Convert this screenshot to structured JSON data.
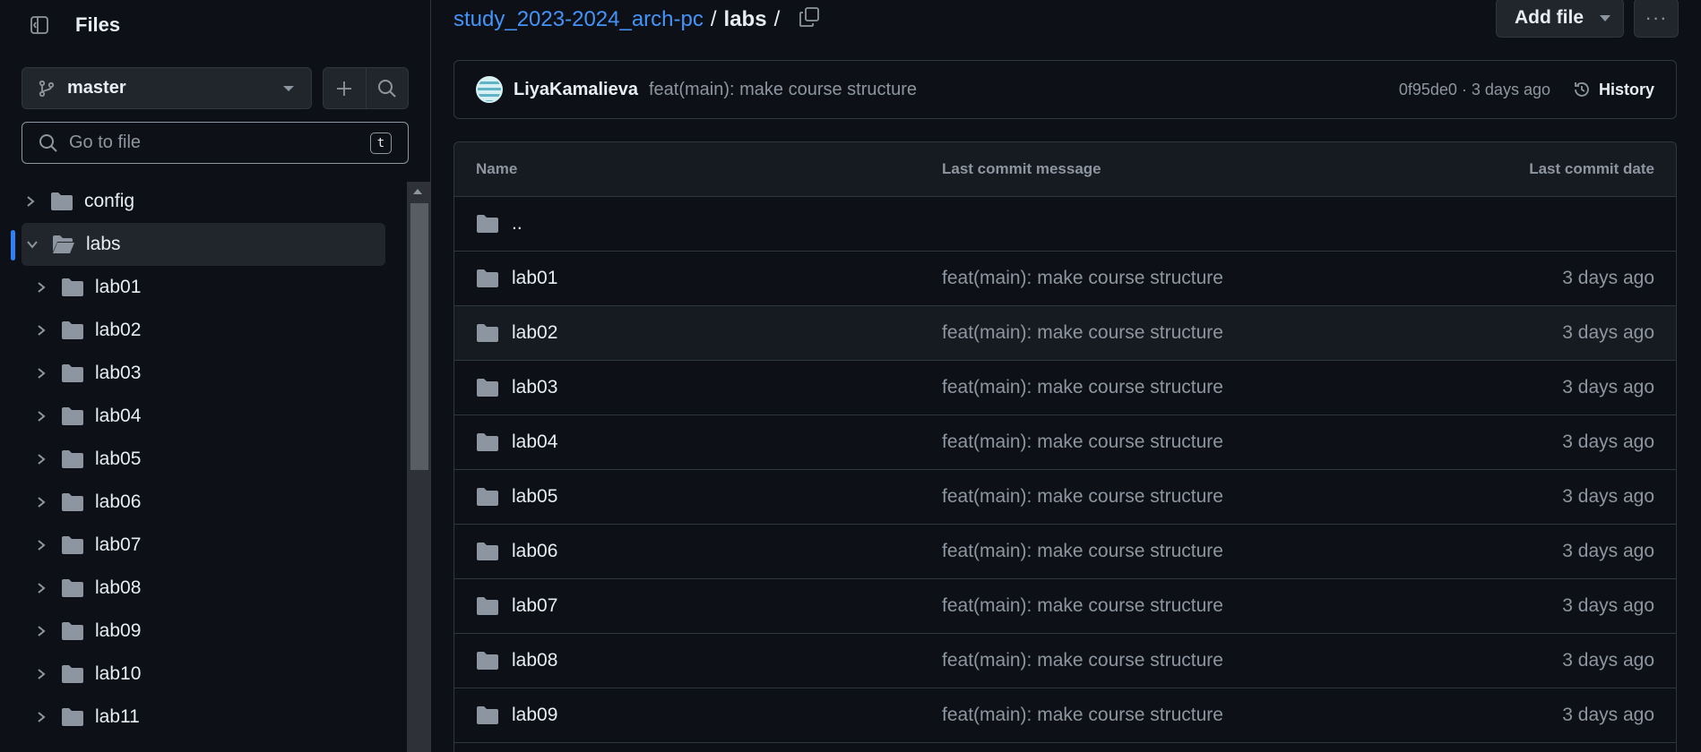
{
  "sidebar": {
    "title": "Files",
    "branch": "master",
    "goto_placeholder": "Go to file",
    "goto_shortcut": "t",
    "tree": [
      {
        "label": "config",
        "expanded": false,
        "depth": 0
      },
      {
        "label": "labs",
        "expanded": true,
        "depth": 0,
        "active": true
      },
      {
        "label": "lab01",
        "expanded": false,
        "depth": 1
      },
      {
        "label": "lab02",
        "expanded": false,
        "depth": 1
      },
      {
        "label": "lab03",
        "expanded": false,
        "depth": 1
      },
      {
        "label": "lab04",
        "expanded": false,
        "depth": 1
      },
      {
        "label": "lab05",
        "expanded": false,
        "depth": 1
      },
      {
        "label": "lab06",
        "expanded": false,
        "depth": 1
      },
      {
        "label": "lab07",
        "expanded": false,
        "depth": 1
      },
      {
        "label": "lab08",
        "expanded": false,
        "depth": 1
      },
      {
        "label": "lab09",
        "expanded": false,
        "depth": 1
      },
      {
        "label": "lab10",
        "expanded": false,
        "depth": 1
      },
      {
        "label": "lab11",
        "expanded": false,
        "depth": 1
      }
    ]
  },
  "breadcrumb": {
    "repo": "study_2023-2024_arch-pc",
    "sep1": "/",
    "current": "labs",
    "sep2": "/"
  },
  "toolbar": {
    "add_file": "Add file",
    "more": "···"
  },
  "commit": {
    "author": "LiyaKamalieva",
    "message": "feat(main): make course structure",
    "meta": "0f95de0 · 3 days ago",
    "history": "History"
  },
  "table": {
    "headers": {
      "name": "Name",
      "message": "Last commit message",
      "date": "Last commit date"
    },
    "parent": "..",
    "rows": [
      {
        "name": "lab01",
        "message": "feat(main): make course structure",
        "date": "3 days ago"
      },
      {
        "name": "lab02",
        "message": "feat(main): make course structure",
        "date": "3 days ago"
      },
      {
        "name": "lab03",
        "message": "feat(main): make course structure",
        "date": "3 days ago"
      },
      {
        "name": "lab04",
        "message": "feat(main): make course structure",
        "date": "3 days ago"
      },
      {
        "name": "lab05",
        "message": "feat(main): make course structure",
        "date": "3 days ago"
      },
      {
        "name": "lab06",
        "message": "feat(main): make course structure",
        "date": "3 days ago"
      },
      {
        "name": "lab07",
        "message": "feat(main): make course structure",
        "date": "3 days ago"
      },
      {
        "name": "lab08",
        "message": "feat(main): make course structure",
        "date": "3 days ago"
      },
      {
        "name": "lab09",
        "message": "feat(main): make course structure",
        "date": "3 days ago"
      }
    ]
  },
  "colors": {
    "background": "#0d1117",
    "accent": "#4493f8",
    "active_indicator": "#2f81f7",
    "muted_text": "#8d96a0"
  }
}
